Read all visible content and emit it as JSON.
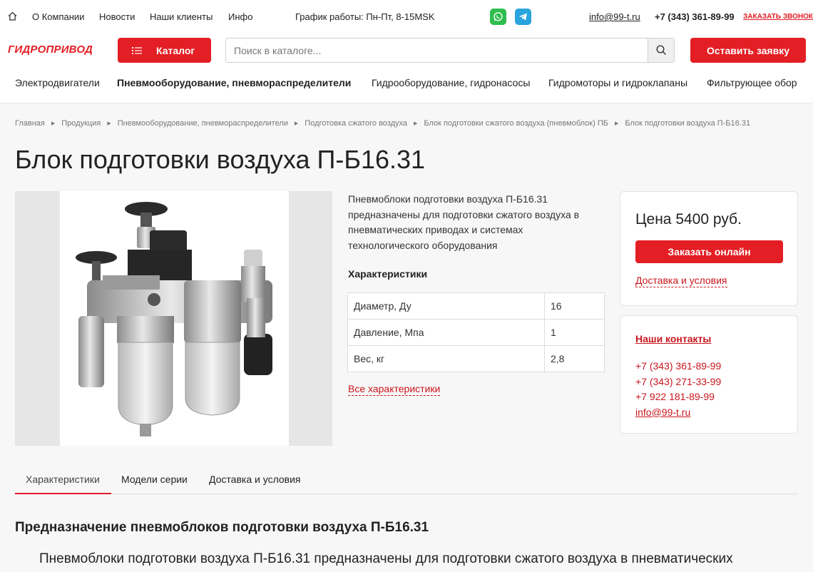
{
  "topbar": {
    "nav": [
      "О Компании",
      "Новости",
      "Наши клиенты",
      "Инфо"
    ],
    "schedule": "График работы: Пн-Пт, 8-15MSK",
    "email": "info@99-t.ru",
    "phone": "+7 (343) 361-89-99",
    "callback": "ЗАКАЗАТЬ ЗВОНОК"
  },
  "header": {
    "logo": "ГИДРОПРИВОД",
    "catalog_label": "Каталог",
    "search_placeholder": "Поиск в каталоге...",
    "search_value": "",
    "request_label": "Оставить заявку"
  },
  "menu": {
    "items": [
      "Электродвигатели",
      "Пневмооборудование, пневмораспределители",
      "Гидрооборудование, гидронасосы",
      "Гидромоторы и гидроклапаны",
      "Фильтрующее обор"
    ],
    "active_index": 1
  },
  "breadcrumbs": [
    "Главная",
    "Продукция",
    "Пневмооборудование, пневмораспределители",
    "Подготовка сжатого воздуха",
    "Блок подготовки сжатого воздуха (пневмоблок) ПБ",
    "Блок подготовки воздуха П-Б16.31"
  ],
  "product": {
    "title": "Блок подготовки воздуха П-Б16.31",
    "description": "Пневмоблоки подготовки воздуха П-Б16.31 предназначены для подготовки сжатого воздуха в пневматических приводах и системах технологического оборудования",
    "characteristics_heading": "Характеристики",
    "specs": [
      {
        "name": "Диаметр, Ду",
        "value": "16"
      },
      {
        "name": "Давление, Мпа",
        "value": "1"
      },
      {
        "name": "Вес, кг",
        "value": "2,8"
      }
    ],
    "all_characteristics": "Все характеристики"
  },
  "price_card": {
    "price": "Цена 5400 руб.",
    "order_label": "Заказать онлайн",
    "delivery_label": "Доставка и условия"
  },
  "contacts": {
    "heading": "Наши контакты",
    "phones": [
      "+7 (343) 361-89-99",
      "+7 (343) 271-33-99",
      "+7 922 181-89-99"
    ],
    "email": "info@99-t.ru"
  },
  "tabs": [
    "Характеристики",
    "Модели серии",
    "Доставка и условия"
  ],
  "section": {
    "heading": "Предназначение пневмоблоков подготовки воздуха П-Б16.31",
    "text": "Пневмоблоки подготовки воздуха П-Б16.31 предназначены для подготовки сжатого воздуха в пневматических"
  },
  "colors": {
    "accent": "#e41e25",
    "whatsapp": "#2ebd4e",
    "telegram": "#2aa4dc"
  }
}
